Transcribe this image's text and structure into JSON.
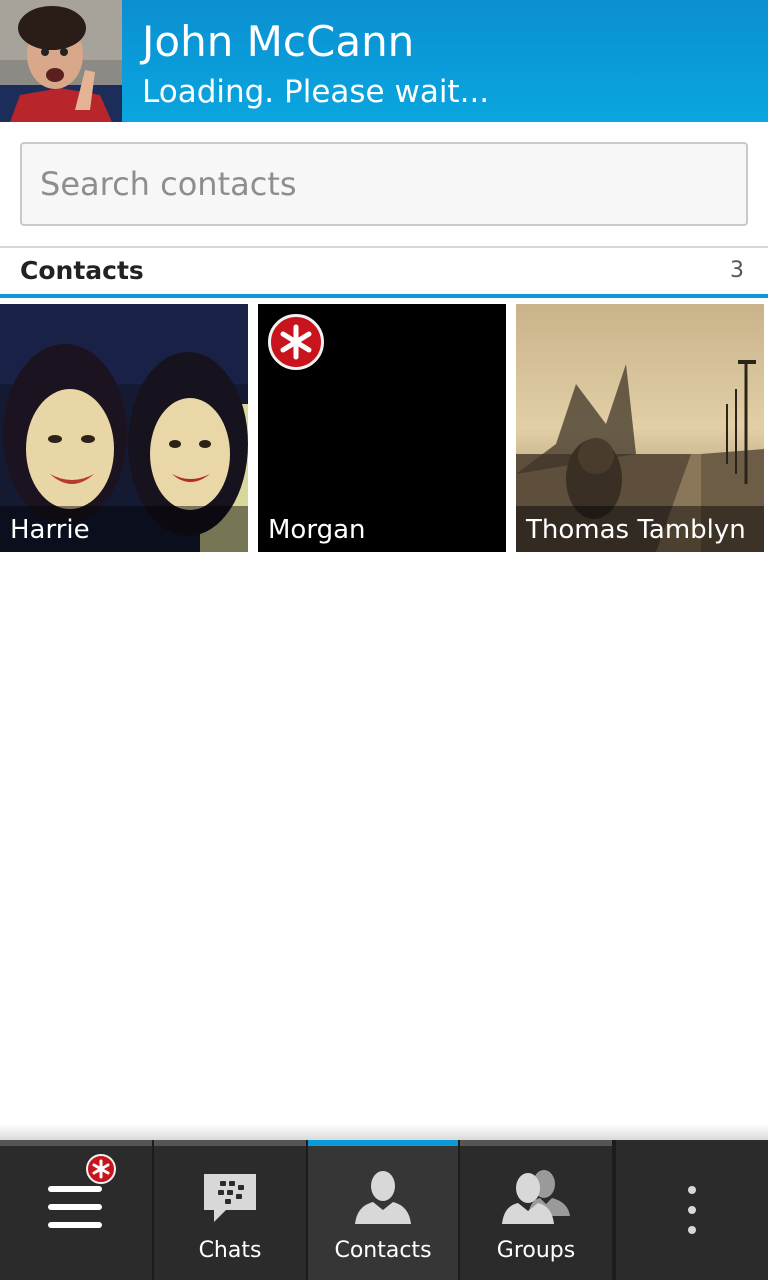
{
  "header": {
    "name": "John McCann",
    "status": "Loading. Please wait..."
  },
  "search": {
    "placeholder": "Search contacts",
    "value": ""
  },
  "section": {
    "title": "Contacts",
    "count": "3"
  },
  "contacts": [
    {
      "name": "Harrie"
    },
    {
      "name": "Morgan"
    },
    {
      "name": "Thomas Tamblyn"
    }
  ],
  "nav": {
    "menu_icon": "hamburger-menu-icon",
    "items": [
      {
        "label": "Chats",
        "icon": "bbm-chat-icon"
      },
      {
        "label": "Contacts",
        "icon": "person-icon",
        "active": true
      },
      {
        "label": "Groups",
        "icon": "group-icon"
      }
    ],
    "overflow_icon": "more-vertical-icon"
  },
  "colors": {
    "accent": "#0a9ad8",
    "header_bg": "#0aa6e0",
    "badge": "#c8141c",
    "bottom_bar": "#2b2b2b"
  }
}
